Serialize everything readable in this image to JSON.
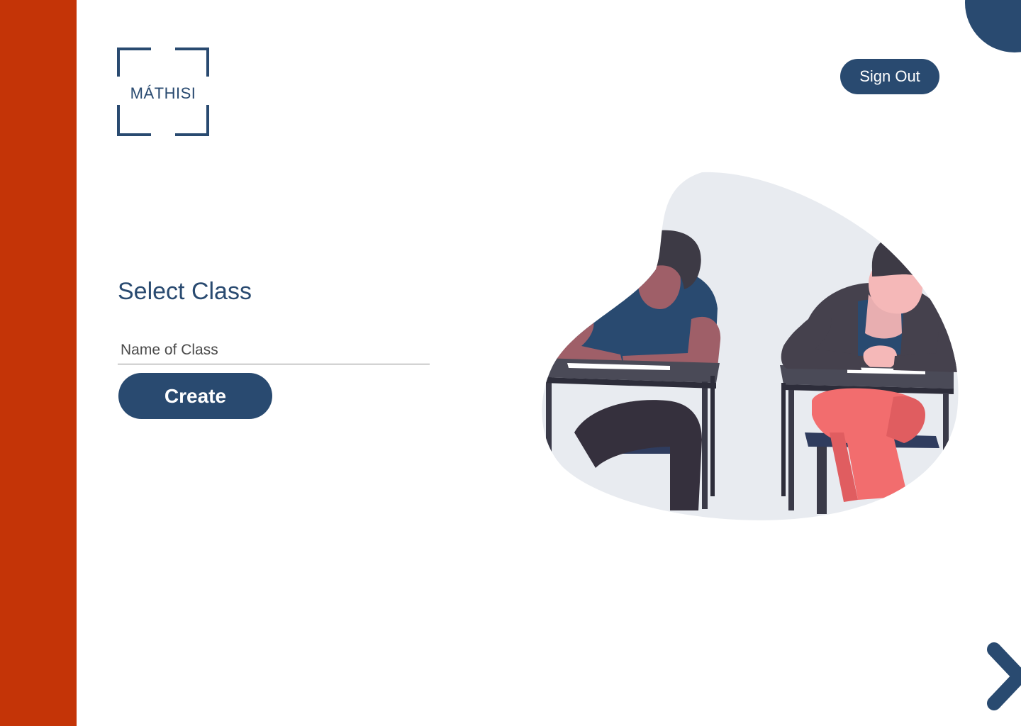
{
  "brand": {
    "name": "MÁTHISI",
    "accent_color": "#c43407",
    "primary_color": "#294a70"
  },
  "header": {
    "sign_out_label": "Sign Out"
  },
  "main": {
    "title": "Select Class",
    "class_input": {
      "placeholder": "Name of Class",
      "value": ""
    },
    "create_label": "Create"
  },
  "illustration": {
    "icon": "students-writing-at-desks-illustration"
  },
  "navigation": {
    "next_icon": "chevron-right-icon"
  }
}
